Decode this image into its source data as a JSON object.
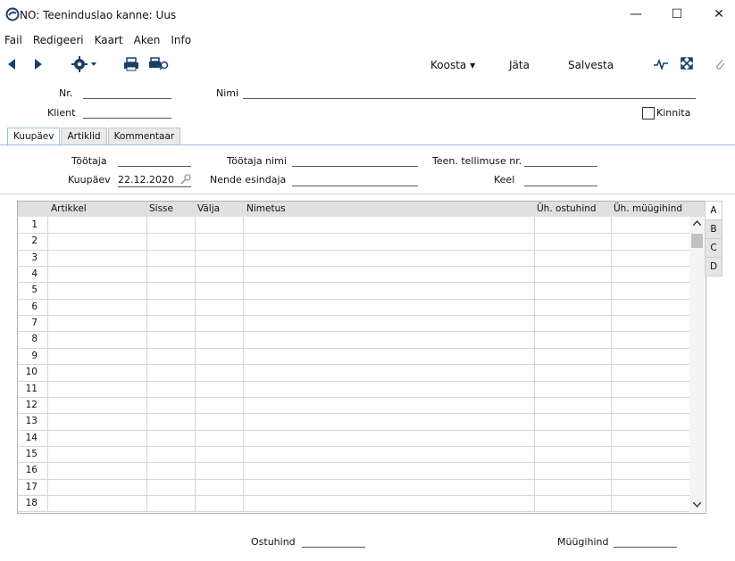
{
  "window": {
    "title": "NO: Teeninduslao kanne: Uus",
    "minimize": "—",
    "maximize": "☐",
    "close": "✕"
  },
  "menu": [
    "Fail",
    "Redigeeri",
    "Kaart",
    "Aken",
    "Info"
  ],
  "toolbar": {
    "koosta": "Koosta ▾",
    "jata": "Jäta",
    "salvesta": "Salvesta"
  },
  "header": {
    "nr_label": "Nr.",
    "nr_value": "",
    "nimi_label": "Nimi",
    "nimi_value": "",
    "klient_label": "Klient",
    "klient_value": "",
    "kinnita_label": "Kinnita"
  },
  "tabs": [
    "Kuupäev",
    "Artiklid",
    "Kommentaar"
  ],
  "form": {
    "tootaja_label": "Töötaja",
    "tootaja_value": "",
    "tootaja_nimi_label": "Töötaja nimi",
    "tootaja_nimi_value": "",
    "teen_tellimuse_label": "Teen. tellimuse nr.",
    "teen_tellimuse_value": "",
    "kuupaev_label": "Kuupäev",
    "kuupaev_value": "22.12.2020",
    "nende_esindaja_label": "Nende esindaja",
    "nende_esindaja_value": "",
    "keel_label": "Keel",
    "keel_value": ""
  },
  "grid": {
    "columns": [
      "Artikkel",
      "Sisse",
      "Välja",
      "Nimetus",
      "Üh. ostuhind",
      "Üh. müügihind"
    ],
    "rows": [
      "1",
      "2",
      "3",
      "4",
      "5",
      "6",
      "7",
      "8",
      "9",
      "10",
      "11",
      "12",
      "13",
      "14",
      "15",
      "16",
      "17",
      "18"
    ],
    "side_tabs": [
      "A",
      "B",
      "C",
      "D"
    ]
  },
  "footer": {
    "ostuhind_label": "Ostuhind",
    "ostuhind_value": "",
    "muugihind_label": "Müügihind",
    "muugihind_value": ""
  },
  "colors": {
    "accent_line": "#9fc0e0",
    "grid_header": "#e0e0e0"
  }
}
